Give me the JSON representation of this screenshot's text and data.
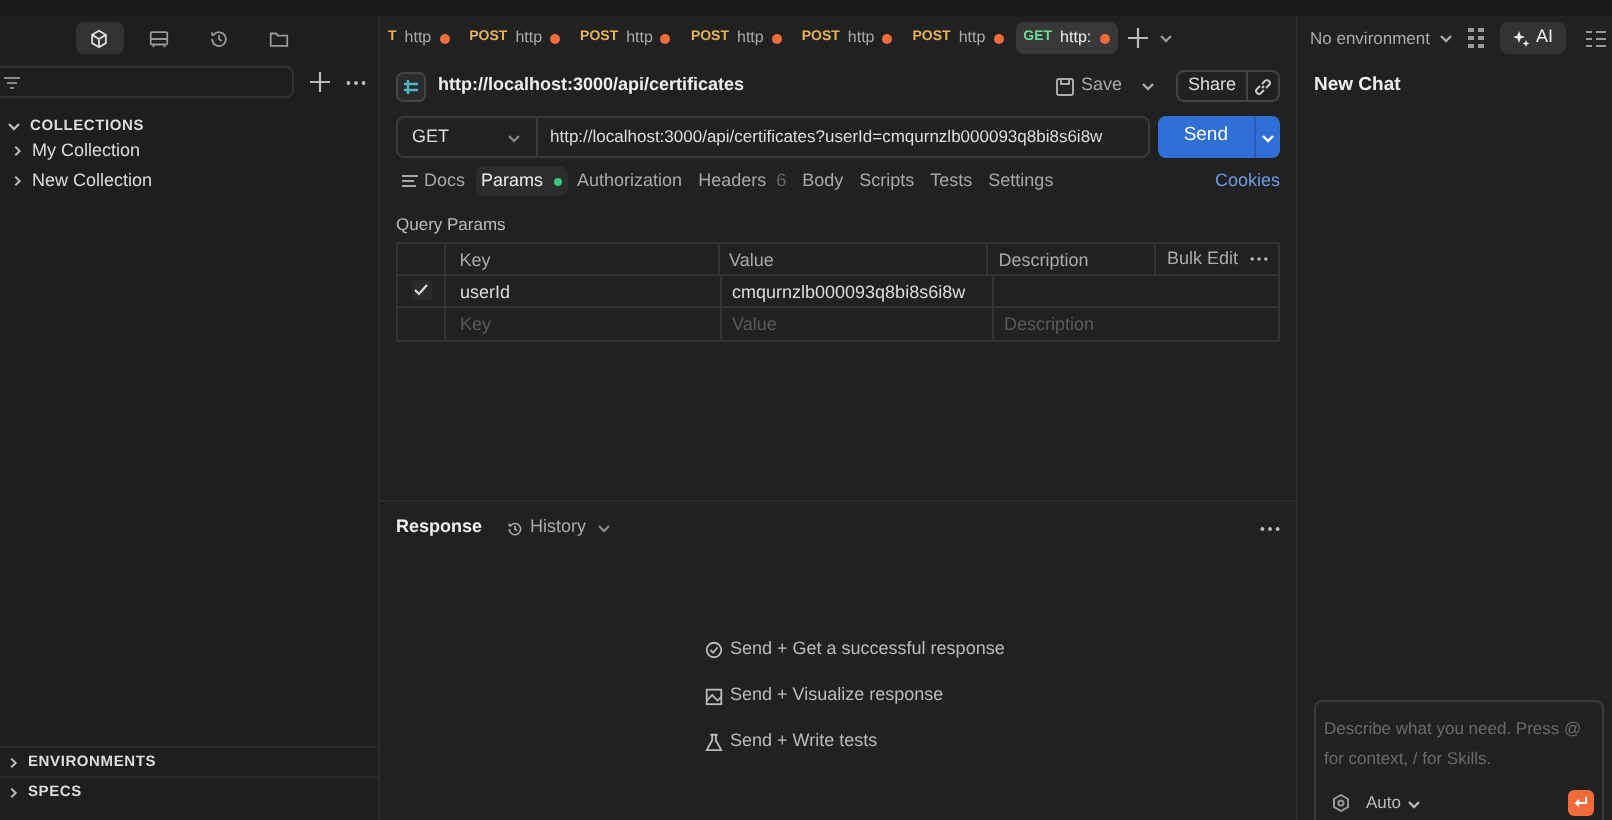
{
  "sidebar": {
    "nav_icons": [
      {
        "kind": "cube",
        "selected": true
      },
      {
        "kind": "monitor",
        "selected": false
      },
      {
        "kind": "history",
        "selected": false
      },
      {
        "kind": "folder",
        "selected": false
      }
    ],
    "section_title": "COLLECTIONS",
    "collections": [
      {
        "label": "My Collection",
        "expanded": false
      },
      {
        "label": "New Collection",
        "expanded": false
      }
    ],
    "bottom_sections": [
      {
        "label": "ENVIRONMENTS",
        "expanded": false
      },
      {
        "label": "SPECS",
        "expanded": false
      }
    ]
  },
  "tabs": [
    {
      "method": "T",
      "label": "http",
      "selected": false,
      "unsaved": true
    },
    {
      "method": "POST",
      "label": "http",
      "selected": false,
      "unsaved": true
    },
    {
      "method": "POST",
      "label": "http",
      "selected": false,
      "unsaved": true
    },
    {
      "method": "POST",
      "label": "http",
      "selected": false,
      "unsaved": true
    },
    {
      "method": "POST",
      "label": "http",
      "selected": false,
      "unsaved": true
    },
    {
      "method": "POST",
      "label": "http",
      "selected": false,
      "unsaved": true
    },
    {
      "method": "GET",
      "label": "http:",
      "selected": true,
      "unsaved": true
    }
  ],
  "environment": "No environment",
  "ai_tab": {
    "label": "AI",
    "selected": true
  },
  "request": {
    "title": "http://localhost:3000/api/certificates",
    "save": "Save",
    "share": "Share",
    "method": "GET",
    "url": "http://localhost:3000/api/certificates?userId=cmqurnzlb000093q8bi8s6i8w",
    "send": "Send",
    "subtabs": [
      {
        "label": "Docs",
        "selected": false
      },
      {
        "label": "Params",
        "selected": true,
        "dot": true
      },
      {
        "label": "Authorization",
        "selected": false
      },
      {
        "label": "Headers",
        "count": "6",
        "selected": false
      },
      {
        "label": "Body",
        "selected": false
      },
      {
        "label": "Scripts",
        "selected": false
      },
      {
        "label": "Tests",
        "selected": false
      },
      {
        "label": "Settings",
        "selected": false
      }
    ],
    "cookies": "Cookies"
  },
  "params": {
    "title": "Query Params",
    "columns": [
      "Key",
      "Value",
      "Description"
    ],
    "bulk_edit": "Bulk Edit",
    "rows": [
      {
        "checked": true,
        "key": "userId",
        "value": "cmqurnzlb000093q8bi8s6i8w"
      }
    ],
    "new_row": {
      "key_placeholder": "Key",
      "value_placeholder": "Value",
      "description_placeholder": "Description"
    }
  },
  "response": {
    "title": "Response",
    "history": "History",
    "hints": [
      {
        "kind": "check",
        "text": "Send + Get a successful response"
      },
      {
        "kind": "image",
        "text": "Send + Visualize response"
      },
      {
        "kind": "flask",
        "text": "Send + Write tests"
      }
    ]
  },
  "chat": {
    "title": "New Chat",
    "placeholder": "Describe what you need. Press @ for context, / for Skills.",
    "mode": "Auto"
  }
}
